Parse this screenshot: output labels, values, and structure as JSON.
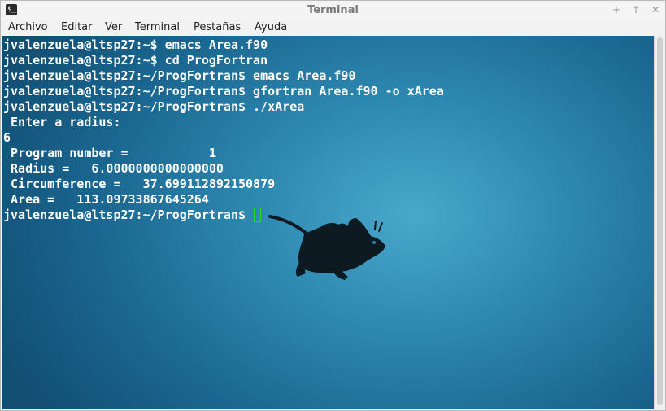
{
  "window": {
    "title": "Terminal",
    "app_icon": "terminal-icon",
    "controls": [
      "minimize-icon",
      "maximize-icon",
      "close-icon"
    ],
    "control_glyphs": {
      "minimize": "+",
      "maximize": "↑",
      "close": "✕"
    }
  },
  "menubar": {
    "items": [
      "Archivo",
      "Editar",
      "Ver",
      "Terminal",
      "Pestañas",
      "Ayuda"
    ]
  },
  "terminal": {
    "lines": [
      "jvalenzuela@ltsp27:~$ emacs Area.f90",
      "jvalenzuela@ltsp27:~$ cd ProgFortran",
      "jvalenzuela@ltsp27:~/ProgFortran$ emacs Area.f90",
      "jvalenzuela@ltsp27:~/ProgFortran$ gfortran Area.f90 -o xArea",
      "jvalenzuela@ltsp27:~/ProgFortran$ ./xArea",
      " Enter a radius:",
      "6",
      " Program number =           1",
      " Radius =   6.0000000000000000",
      " Circumference =   37.699112892150879",
      " Area =   113.09733867645264",
      "jvalenzuela@ltsp27:~/ProgFortran$ "
    ],
    "background_colors": [
      "#4aa8cc",
      "#1a6690",
      "#124e72"
    ],
    "text_color": "#ffffff",
    "cursor_color": "#22dd22",
    "wallpaper_icon": "xfce-mouse-icon"
  }
}
